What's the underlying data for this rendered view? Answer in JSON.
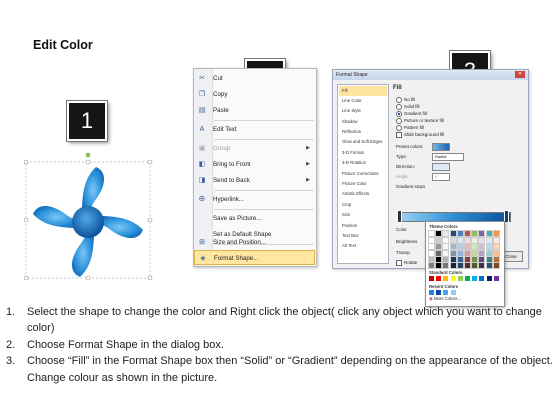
{
  "title": "Edit Color",
  "step_numbers": [
    "1",
    "2",
    "3"
  ],
  "context_menu": {
    "items": [
      {
        "label": "Cut",
        "icon": "scissors-icon"
      },
      {
        "label": "Copy",
        "icon": "copy-icon"
      },
      {
        "label": "Paste",
        "icon": "paste-icon"
      },
      {
        "label": "Edit Text",
        "icon": "edit-text-icon"
      },
      {
        "label": "Group",
        "icon": "group-icon",
        "disabled": true,
        "submenu": true
      },
      {
        "label": "Bring to Front",
        "icon": "bring-front-icon",
        "submenu": true
      },
      {
        "label": "Send to Back",
        "icon": "send-back-icon",
        "submenu": true
      },
      {
        "label": "Hyperlink...",
        "icon": "hyperlink-icon"
      },
      {
        "label": "Save as Picture...",
        "icon": ""
      },
      {
        "label": "Set as Default Shape",
        "icon": ""
      },
      {
        "label": "Size and Position...",
        "icon": "size-icon"
      },
      {
        "label": "Format Shape...",
        "icon": "format-shape-icon",
        "highlighted": true
      }
    ]
  },
  "format_dialog": {
    "title": "Format Shape",
    "nav": [
      "Fill",
      "Line Color",
      "Line Style",
      "Shadow",
      "Reflection",
      "Glow and Soft Edges",
      "3-D Format",
      "3-D Rotation",
      "Picture Corrections",
      "Picture Color",
      "Artistic Effects",
      "Crop",
      "Size",
      "Position",
      "Text Box",
      "Alt Text"
    ],
    "pane_title": "Fill",
    "options": [
      "No fill",
      "Solid fill",
      "Gradient fill",
      "Picture or texture fill",
      "Pattern fill",
      "Slide background fill"
    ],
    "selected_option": "Gradient fill",
    "preset_colors_label": "Preset colors:",
    "type_label": "Type:",
    "type_value": "Radial",
    "direction_label": "Direction:",
    "angle_label": "Angle:",
    "angle_value": "0°",
    "gradient_stops_label": "Gradient stops",
    "color_label": "Color",
    "position_label": "Position:",
    "position_value": "93%",
    "brightness_label": "Brightness",
    "transparency_label": "Transp",
    "rotate_label": "Rotate",
    "close_label": "Close"
  },
  "palette": {
    "theme_label": "Theme Colors",
    "standard_label": "Standard Colors",
    "recent_label": "Recent Colors",
    "more_label": "More Colors...",
    "theme_top": [
      "#ffffff",
      "#000000",
      "#eeece1",
      "#1f497d",
      "#4f81bd",
      "#c0504d",
      "#9bbb59",
      "#8064a2",
      "#4bacc6",
      "#f79646"
    ],
    "standard": [
      "#c00000",
      "#ff0000",
      "#ffc000",
      "#ffff00",
      "#92d050",
      "#00b050",
      "#00b0f0",
      "#0070c0",
      "#002060",
      "#7030a0"
    ],
    "recent": [
      "#1e88e5",
      "#0d47a1",
      "#42a5f5",
      "#90caf9"
    ]
  },
  "steps": [
    {
      "n": "1.",
      "text": "Select the shape to change the color and Right click the object( click any object which you want to change color)"
    },
    {
      "n": "2.",
      "text": "Choose Format Shape in the dialog box."
    },
    {
      "n": "3.",
      "text": "Choose “Fill” in the Format Shape box then “Solid” or “Gradient” depending on the appearance of the object. Change colour as shown in the picture."
    }
  ]
}
